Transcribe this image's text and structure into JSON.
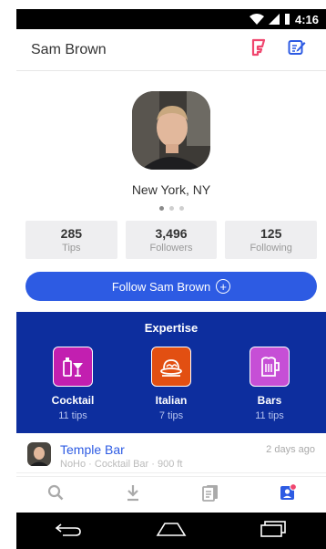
{
  "status_bar": {
    "time": "4:16"
  },
  "header": {
    "title": "Sam Brown"
  },
  "profile": {
    "location": "New York, NY"
  },
  "stats": [
    {
      "value": "285",
      "label": "Tips"
    },
    {
      "value": "3,496",
      "label": "Followers"
    },
    {
      "value": "125",
      "label": "Following"
    }
  ],
  "follow_button": {
    "label": "Follow Sam Brown"
  },
  "expertise": {
    "heading": "Expertise",
    "items": [
      {
        "name": "Cocktail",
        "count": "11 tips",
        "color": "#c21fb0"
      },
      {
        "name": "Italian",
        "count": "7 tips",
        "color": "#e24f12"
      },
      {
        "name": "Bars",
        "count": "11 tips",
        "color": "#c64fd6"
      }
    ]
  },
  "feed": {
    "title": "Temple Bar",
    "subtitle": "NoHo · Cocktail Bar · 900 ft",
    "time": "2 days ago"
  },
  "colors": {
    "accent": "#2d5be3",
    "expertise_bg": "#0d2e9e",
    "foursquare_pink": "#f0466e"
  }
}
